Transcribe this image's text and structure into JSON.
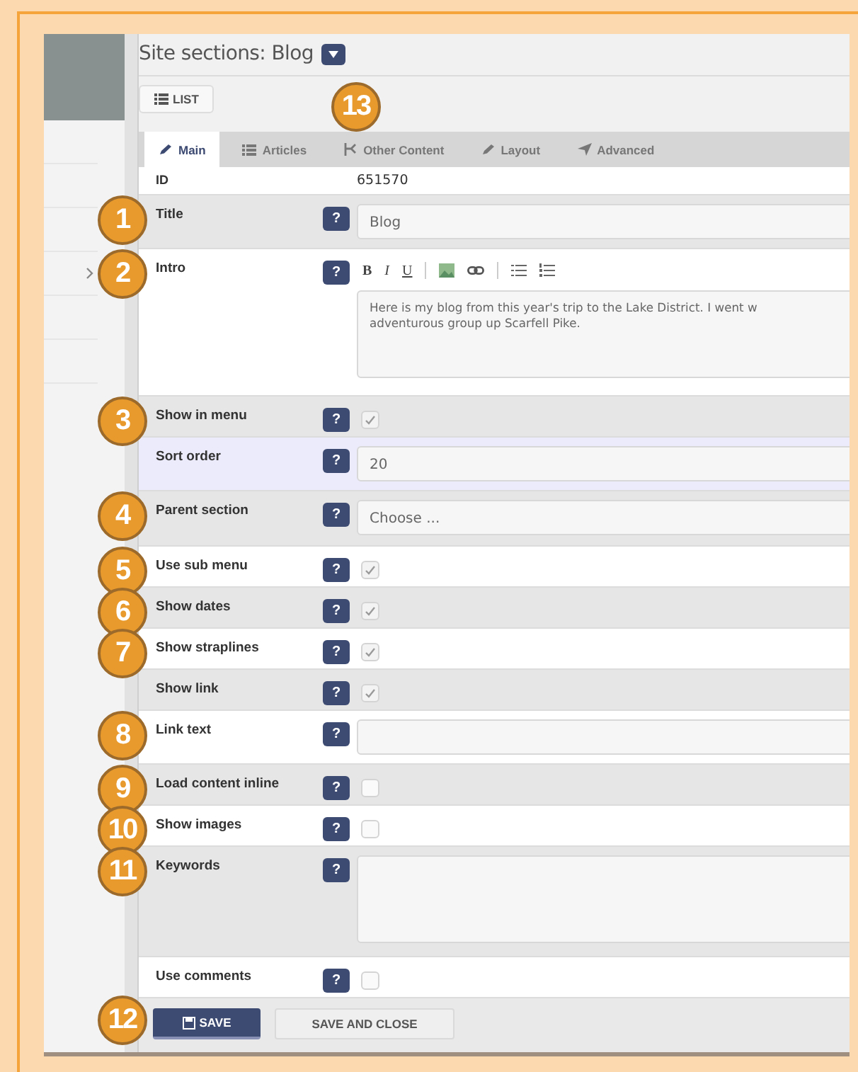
{
  "page": {
    "title": "Site sections: Blog",
    "list_button": "LIST"
  },
  "tabs_callout": "13",
  "tabs": [
    {
      "kind": "pencil",
      "label": "Main",
      "selected": true
    },
    {
      "kind": "list",
      "label": "Articles",
      "selected": false
    },
    {
      "kind": "branch",
      "label": "Other Content",
      "selected": false
    },
    {
      "kind": "pencil",
      "label": "Layout",
      "selected": false
    },
    {
      "kind": "plane",
      "label": "Advanced",
      "selected": false
    }
  ],
  "id_row": {
    "label": "ID",
    "value": "651570"
  },
  "fields": [
    {
      "kind": "text",
      "label": "Title",
      "help": "?",
      "value": "Blog",
      "callout": "1",
      "highlighted": false
    },
    {
      "kind": "richtext",
      "label": "Intro",
      "help": "?",
      "toolbar": [
        "B",
        "I",
        "U"
      ],
      "value": "Here is my blog from this year's trip to the Lake District. I went w\nadventurous group up Scarfell Pike.",
      "callout": "2",
      "highlighted": false
    },
    {
      "kind": "checkbox",
      "label": "Show in menu",
      "help": "?",
      "checked": true,
      "callout": "3",
      "highlighted": false
    },
    {
      "kind": "text",
      "label": "Sort order",
      "help": "?",
      "value": "20",
      "highlighted": true
    },
    {
      "kind": "select",
      "label": "Parent section",
      "help": "?",
      "value": "Choose ...",
      "callout": "4",
      "highlighted": false
    },
    {
      "kind": "checkbox",
      "label": "Use sub menu",
      "help": "?",
      "checked": true,
      "callout": "5",
      "highlighted": false
    },
    {
      "kind": "checkbox",
      "label": "Show dates",
      "help": "?",
      "checked": true,
      "callout": "6",
      "highlighted": false
    },
    {
      "kind": "checkbox",
      "label": "Show straplines",
      "help": "?",
      "checked": true,
      "callout": "7",
      "highlighted": false
    },
    {
      "kind": "checkbox",
      "label": "Show link",
      "help": "?",
      "checked": true,
      "highlighted": false
    },
    {
      "kind": "text",
      "label": "Link text",
      "help": "?",
      "callout": "8",
      "highlighted": false
    },
    {
      "kind": "checkbox",
      "label": "Load content inline",
      "help": "?",
      "checked": false,
      "callout": "9",
      "highlighted": false
    },
    {
      "kind": "checkbox",
      "label": "Show images",
      "help": "?",
      "checked": false,
      "callout": "10",
      "highlighted": false
    },
    {
      "kind": "textarea",
      "label": "Keywords",
      "help": "?",
      "callout": "11",
      "highlighted": false
    },
    {
      "kind": "checkbox",
      "label": "Use comments",
      "help": "?",
      "checked": false,
      "highlighted": false
    }
  ],
  "buttons_callout": "12",
  "buttons": [
    {
      "kind": "primary",
      "label": "SAVE"
    },
    {
      "kind": "secondary",
      "label": "SAVE AND CLOSE"
    }
  ]
}
